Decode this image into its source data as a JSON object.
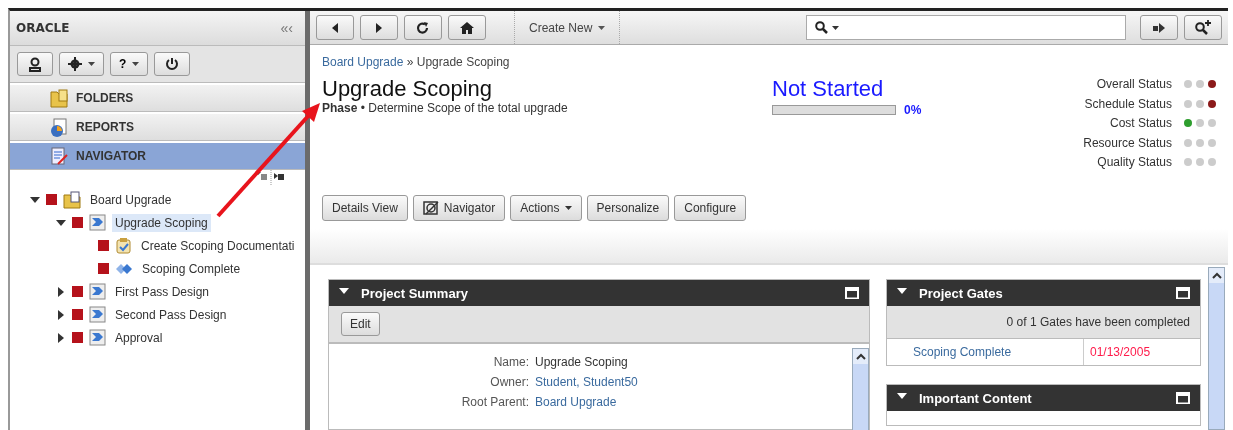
{
  "brand": {
    "logo": "ORACLE",
    "collapse": "«‹"
  },
  "sidebar": {
    "tool_buttons": [
      {
        "kind": "user",
        "dropdown": false
      },
      {
        "kind": "settings",
        "dropdown": true
      },
      {
        "kind": "help",
        "label": "?",
        "dropdown": true
      },
      {
        "kind": "power",
        "dropdown": false
      }
    ],
    "accordion": [
      {
        "label": "FOLDERS",
        "kind": "folders",
        "selected": false
      },
      {
        "label": "REPORTS",
        "kind": "reports",
        "selected": false
      },
      {
        "label": "NAVIGATOR",
        "kind": "navigator",
        "selected": true
      }
    ],
    "tree": [
      {
        "label": "Board Upgrade",
        "kind": "project",
        "color": "#b5121b",
        "expanded": true,
        "selected": false,
        "children": [
          {
            "label": "Upgrade Scoping",
            "kind": "phase",
            "color": "#b5121b",
            "expanded": true,
            "selected": true,
            "children": [
              {
                "label": "Create Scoping Documentati",
                "kind": "task",
                "color": "#b5121b",
                "selected": false
              },
              {
                "label": "Scoping Complete",
                "kind": "gate",
                "color": "#b5121b",
                "selected": false
              }
            ]
          },
          {
            "label": "First Pass Design",
            "kind": "phase",
            "color": "#b5121b",
            "expanded": false,
            "selected": false
          },
          {
            "label": "Second Pass Design",
            "kind": "phase",
            "color": "#b5121b",
            "expanded": false,
            "selected": false
          },
          {
            "label": "Approval",
            "kind": "phase",
            "color": "#b5121b",
            "expanded": false,
            "selected": false
          }
        ]
      }
    ]
  },
  "toolbar": {
    "buttons": [
      {
        "kind": "back"
      },
      {
        "kind": "forward"
      },
      {
        "kind": "refresh"
      },
      {
        "kind": "home"
      }
    ],
    "create_new": "Create New"
  },
  "breadcrumb": {
    "items": [
      "Board Upgrade",
      "Upgrade Scoping"
    ],
    "separator": "»"
  },
  "header": {
    "title": "Upgrade Scoping",
    "subtitle": "**Phase** • Determine Scope of the total upgrade",
    "status": "Not Started",
    "progress": {
      "level": 0,
      "reading": "0%"
    }
  },
  "statuses": [
    {
      "label": "Overall Status",
      "lights": [
        {
          "color": "#cccccc"
        },
        {
          "color": "#cccccc"
        },
        {
          "color": "#8b1a1a"
        }
      ]
    },
    {
      "label": "Schedule Status",
      "lights": [
        {
          "color": "#cccccc"
        },
        {
          "color": "#cccccc"
        },
        {
          "color": "#8b1a1a"
        }
      ]
    },
    {
      "label": "Cost Status",
      "lights": [
        {
          "color": "#2e9e2e"
        },
        {
          "color": "#cccccc"
        },
        {
          "color": "#cccccc"
        }
      ]
    },
    {
      "label": "Resource Status",
      "lights": [
        {
          "color": "#cccccc"
        },
        {
          "color": "#cccccc"
        },
        {
          "color": "#cccccc"
        }
      ]
    },
    {
      "label": "Quality Status",
      "lights": [
        {
          "color": "#cccccc"
        },
        {
          "color": "#cccccc"
        },
        {
          "color": "#cccccc"
        }
      ]
    }
  ],
  "actions": [
    {
      "label": "Details View",
      "kind": "plain"
    },
    {
      "label": "Navigator",
      "kind": "icon"
    },
    {
      "label": "Actions",
      "kind": "menu"
    },
    {
      "label": "Personalize",
      "kind": "plain"
    },
    {
      "label": "Configure",
      "kind": "plain"
    }
  ],
  "project_summary": {
    "title": "Project Summary",
    "expanded": true,
    "buttons": [
      "Edit"
    ],
    "fields": [
      {
        "label": "Name:",
        "value": "Upgrade Scoping",
        "kind": "text"
      },
      {
        "label": "Owner:",
        "value": "Student, Student50",
        "kind": "link"
      },
      {
        "label": "Root Parent:",
        "value": "Board Upgrade",
        "kind": "link"
      }
    ]
  },
  "project_gates": {
    "title": "Project Gates",
    "expanded": true,
    "summary": "0 of 1 Gates have been completed",
    "rows": [
      {
        "name": "Scoping Complete",
        "date": "01/13/2005"
      }
    ]
  },
  "important_content": {
    "title": "Important Content",
    "expanded": true
  }
}
